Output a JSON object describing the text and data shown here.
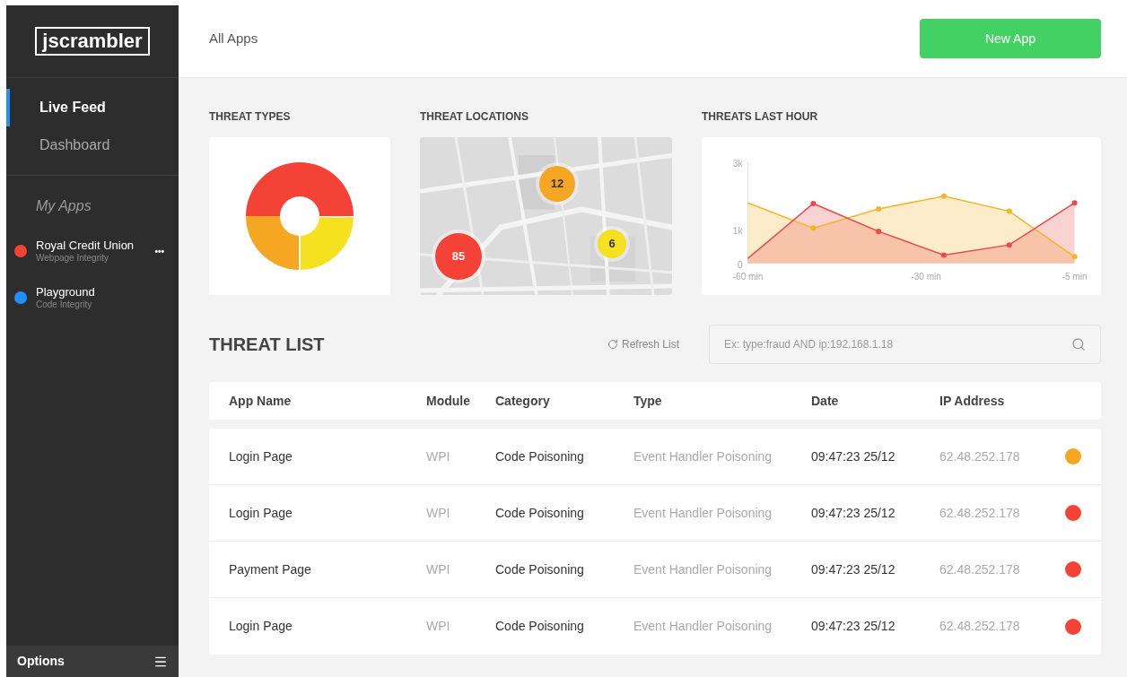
{
  "sidebar": {
    "logo": "jscrambler",
    "nav": [
      {
        "label": "Live Feed",
        "selected": true
      },
      {
        "label": "Dashboard",
        "selected": false
      }
    ],
    "apps_heading": "My Apps",
    "apps": [
      {
        "name": "Royal Credit Union",
        "module": "Webpage Integrity",
        "color": "#f44336",
        "menu": "•••"
      },
      {
        "name": "Playground",
        "module": "Code Integrity",
        "color": "#1e90ff"
      }
    ],
    "footer": "Options"
  },
  "header": {
    "title": "All Apps",
    "button": "New App"
  },
  "threat_types": {
    "title": "THREAT TYPES"
  },
  "threat_locations": {
    "title": "THREAT LOCATIONS",
    "markers": [
      {
        "count": "12",
        "color": "#f5a623"
      },
      {
        "count": "85",
        "color": "#f44336"
      },
      {
        "count": "6",
        "color": "#f5e11f"
      }
    ]
  },
  "threats_last_hour": {
    "title": "THREATS LAST HOUR",
    "chart_data": {
      "type": "area",
      "x": [
        -60,
        -49,
        -38,
        -27,
        -16,
        -5
      ],
      "xlim": [
        -60,
        -5
      ],
      "ylim": [
        0,
        3000
      ],
      "xticks": [
        {
          "value": -60,
          "label": "-60 min"
        },
        {
          "value": -30,
          "label": "-30 min"
        },
        {
          "value": -5,
          "label": "-5 min"
        }
      ],
      "yticks": [
        {
          "value": 0,
          "label": "0"
        },
        {
          "value": 1000,
          "label": "1k"
        },
        {
          "value": 3000,
          "label": "3k"
        }
      ],
      "series": [
        {
          "color": "#f5b52a",
          "values": [
            1800,
            1050,
            1620,
            2000,
            1550,
            200
          ]
        },
        {
          "color": "#e84b4b",
          "values": [
            150,
            1780,
            950,
            250,
            550,
            1800
          ]
        }
      ]
    }
  },
  "threat_list": {
    "title": "THREAT LIST",
    "refresh": "Refresh List",
    "search_placeholder": "Ex: type:fraud AND ip:192.168.1.18",
    "columns": [
      "App Name",
      "Module",
      "Category",
      "Type",
      "Date",
      "IP Address"
    ],
    "rows": [
      {
        "app": "Login Page",
        "module": "WPI",
        "category": "Code Poisoning",
        "type": "Event Handler Poisoning",
        "date": "09:47:23 25/12",
        "ip": "62.48.252.178",
        "color": "#f5a623"
      },
      {
        "app": "Login Page",
        "module": "WPI",
        "category": "Code Poisoning",
        "type": "Event Handler Poisoning",
        "date": "09:47:23 25/12",
        "ip": "62.48.252.178",
        "color": "#f44336"
      },
      {
        "app": "Payment Page",
        "module": "WPI",
        "category": "Code Poisoning",
        "type": "Event Handler Poisoning",
        "date": "09:47:23 25/12",
        "ip": "62.48.252.178",
        "color": "#f44336"
      },
      {
        "app": "Login Page",
        "module": "WPI",
        "category": "Code Poisoning",
        "type": "Event Handler Poisoning",
        "date": "09:47:23 25/12",
        "ip": "62.48.252.178",
        "color": "#f44336"
      }
    ]
  }
}
